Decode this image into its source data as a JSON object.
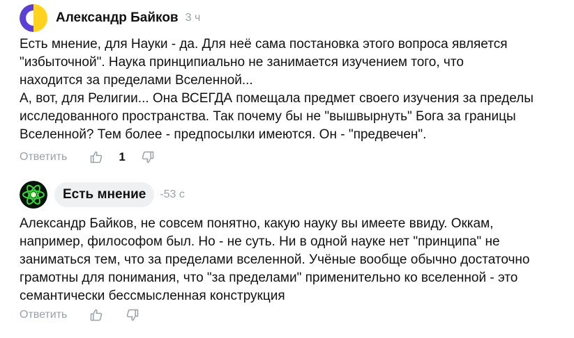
{
  "comments": [
    {
      "author": "Александр Байков",
      "time": "3 ч",
      "text": "Есть мнение, для Науки - да. Для неё сама постановка этого вопроса является\n\"избыточной\". Наука принципиально не занимается изучением того, что\nнаходится за пределами Вселенной...\nА, вот, для Религии... Она ВСЕГДА помещала предмет своего изучения за пределы\nисследованного пространства. Так почему бы не \"вышвырнуть\" Бога за границы\nВселенной? Тем более - предпосылки имеются. Он - \"предвечен\".",
      "reply_label": "Ответить",
      "likes": "1",
      "avatar_icon": "avatar-purple-yellow-icon"
    },
    {
      "author": "Есть мнение",
      "time": "-53 с",
      "text": "Александр Байков, не совсем понятно, какую науку вы имеете ввиду. Оккам,\nнапример, философом был. Но - не суть. Ни в одной науке нет \"принципа\" не\nзаниматься тем, что за пределами вселенной. Учёные вообще обычно достаточно\nграмотны для понимания, что \"за пределами\" применительно ко вселенной - это\nсемантически бессмысленная конструкция",
      "reply_label": "Ответить",
      "likes": "",
      "avatar_icon": "atom-avatar-icon"
    }
  ],
  "colors": {
    "muted": "#9aa0a6",
    "chip_bg": "#eef0f2",
    "avatar_purple": "#5b3fd6",
    "avatar_yellow": "#ffd21f",
    "atom_green": "#39d63c"
  }
}
